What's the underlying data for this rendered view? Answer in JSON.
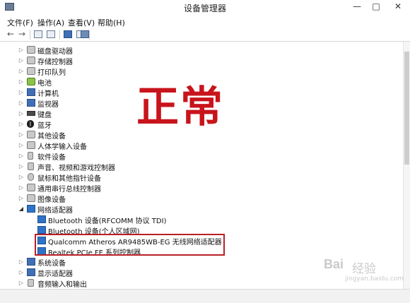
{
  "window": {
    "title": "设备管理器",
    "controls": {
      "minimize": "—",
      "maximize": "□",
      "close": "✕"
    }
  },
  "menu": [
    "文件(F)",
    "操作(A)",
    "查看(V)",
    "帮助(H)"
  ],
  "toolbar": {
    "back": "←",
    "forward": "→"
  },
  "tree": [
    {
      "label": "磁盘驱动器",
      "expanded": false,
      "level": 1,
      "icon": "disk-icon"
    },
    {
      "label": "存储控制器",
      "expanded": false,
      "level": 1,
      "icon": "storage-controller-icon"
    },
    {
      "label": "打印队列",
      "expanded": false,
      "level": 1,
      "icon": "printer-icon"
    },
    {
      "label": "电池",
      "expanded": false,
      "level": 1,
      "icon": "battery-icon"
    },
    {
      "label": "计算机",
      "expanded": false,
      "level": 1,
      "icon": "computer-icon"
    },
    {
      "label": "监视器",
      "expanded": false,
      "level": 1,
      "icon": "monitor-icon"
    },
    {
      "label": "键盘",
      "expanded": false,
      "level": 1,
      "icon": "keyboard-icon"
    },
    {
      "label": "蓝牙",
      "expanded": false,
      "level": 1,
      "icon": "bluetooth-icon"
    },
    {
      "label": "其他设备",
      "expanded": false,
      "level": 1,
      "icon": "other-devices-icon"
    },
    {
      "label": "人体学输入设备",
      "expanded": false,
      "level": 1,
      "icon": "hid-icon"
    },
    {
      "label": "软件设备",
      "expanded": false,
      "level": 1,
      "icon": "software-device-icon"
    },
    {
      "label": "声音、视频和游戏控制器",
      "expanded": false,
      "level": 1,
      "icon": "sound-icon"
    },
    {
      "label": "鼠标和其他指针设备",
      "expanded": false,
      "level": 1,
      "icon": "mouse-icon"
    },
    {
      "label": "通用串行总线控制器",
      "expanded": false,
      "level": 1,
      "icon": "usb-icon"
    },
    {
      "label": "图像设备",
      "expanded": false,
      "level": 1,
      "icon": "camera-icon"
    },
    {
      "label": "网络适配器",
      "expanded": true,
      "level": 1,
      "icon": "network-adapter-icon"
    },
    {
      "label": "Bluetooth 设备(RFCOMM 协议 TDI)",
      "level": 2,
      "icon": "network-adapter-icon"
    },
    {
      "label": "Bluetooth 设备(个人区域网)",
      "level": 2,
      "icon": "network-adapter-icon"
    },
    {
      "label": "Qualcomm Atheros AR9485WB-EG 无线网络适配器",
      "level": 2,
      "icon": "network-adapter-icon"
    },
    {
      "label": "Realtek PCIe FE 系列控制器",
      "level": 2,
      "icon": "network-adapter-icon"
    },
    {
      "label": "系统设备",
      "expanded": false,
      "level": 1,
      "icon": "system-device-icon"
    },
    {
      "label": "显示适配器",
      "expanded": false,
      "level": 1,
      "icon": "display-adapter-icon"
    },
    {
      "label": "音频输入和输出",
      "expanded": false,
      "level": 1,
      "icon": "audio-io-icon"
    }
  ],
  "annotation": {
    "status_text": "正常",
    "color": "#c8141c"
  },
  "watermark": {
    "logo": "Bai",
    "text": "经验",
    "url": "jingyan.baidu.com"
  }
}
